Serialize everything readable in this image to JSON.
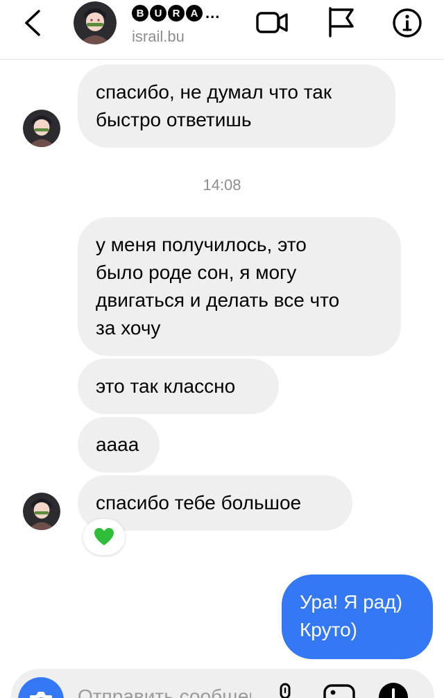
{
  "header": {
    "title_letters": [
      "B",
      "U",
      "R",
      "A"
    ],
    "title_ellipsis": "...",
    "username": "israil.bu"
  },
  "messages": {
    "m1_line1": "спасибо, не думал что так",
    "m1_line2": "быстро ответишь",
    "timestamp": "14:08",
    "m2_line1": "у меня получилось, это",
    "m2_line2": "было роде сон, я могу",
    "m2_line3": "двигаться и делать все что",
    "m2_line4": "за хочу",
    "m3": "это так классно",
    "m4": "аааа",
    "m5": "спасибо тебе большое",
    "reaction_icon": "green-heart-icon",
    "out_line1": "Ура! Я рад)",
    "out_line2": "Круто)"
  },
  "composer": {
    "placeholder": "Отправить сообщение..."
  },
  "colors": {
    "outgoing_bubble": "#3478f6",
    "incoming_bubble": "#efefef",
    "reaction_heart": "#2fbd3a"
  }
}
